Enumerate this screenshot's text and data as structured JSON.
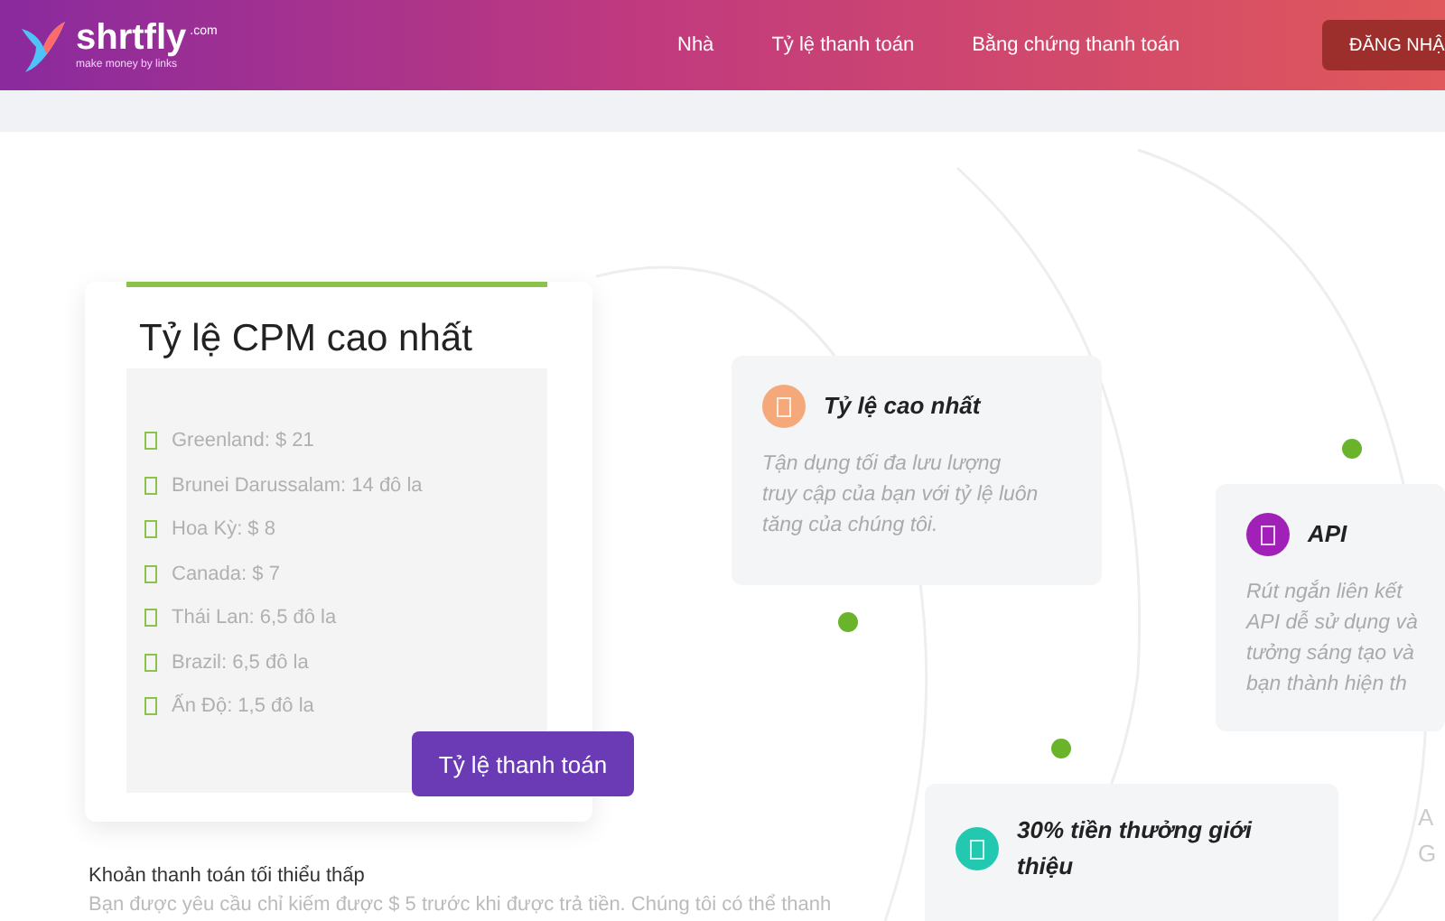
{
  "header": {
    "logo": {
      "name": "shrtfly",
      "suffix": ".com",
      "tagline": "make money by links"
    },
    "nav": [
      {
        "label": "Nhà"
      },
      {
        "label": "Tỷ lệ thanh toán"
      },
      {
        "label": "Bằng chứng thanh toán"
      }
    ],
    "login_button": "ĐĂNG NHẬ"
  },
  "rates_card": {
    "title": "Tỷ lệ CPM cao nhất",
    "items": [
      "Greenland: $ 21",
      "Brunei Darussalam: 14 đô la",
      "Hoa Kỳ: $ 8",
      "Canada: $ 7",
      "Thái Lan: 6,5 đô la",
      "Brazil: 6,5 đô la",
      "Ấn Độ: 1,5 đô la"
    ],
    "button": "Tỷ lệ thanh toán"
  },
  "min_payout": {
    "title": "Khoản thanh toán tối thiểu thấp",
    "text": "Bạn được yêu cầu chỉ kiếm được $ 5 trước khi được trả tiền. Chúng tôi có thể thanh"
  },
  "features": [
    {
      "title": "Tỷ lệ cao nhất",
      "color": "#f5a97a",
      "lines": [
        "Tận dụng tối đa lưu lượng",
        "truy cập của bạn với tỷ lệ luôn",
        "tăng của chúng tôi."
      ]
    },
    {
      "title": "API",
      "color": "#a020b8",
      "lines": [
        "Rút ngắn liên kết",
        "API dễ sử dụng và",
        "tưởng sáng tạo và",
        "bạn thành hiện th"
      ]
    },
    {
      "title": "30% tiền thưởng giới thiệu",
      "color": "#22c9b0"
    }
  ],
  "edge_letters": [
    "A",
    "G"
  ]
}
